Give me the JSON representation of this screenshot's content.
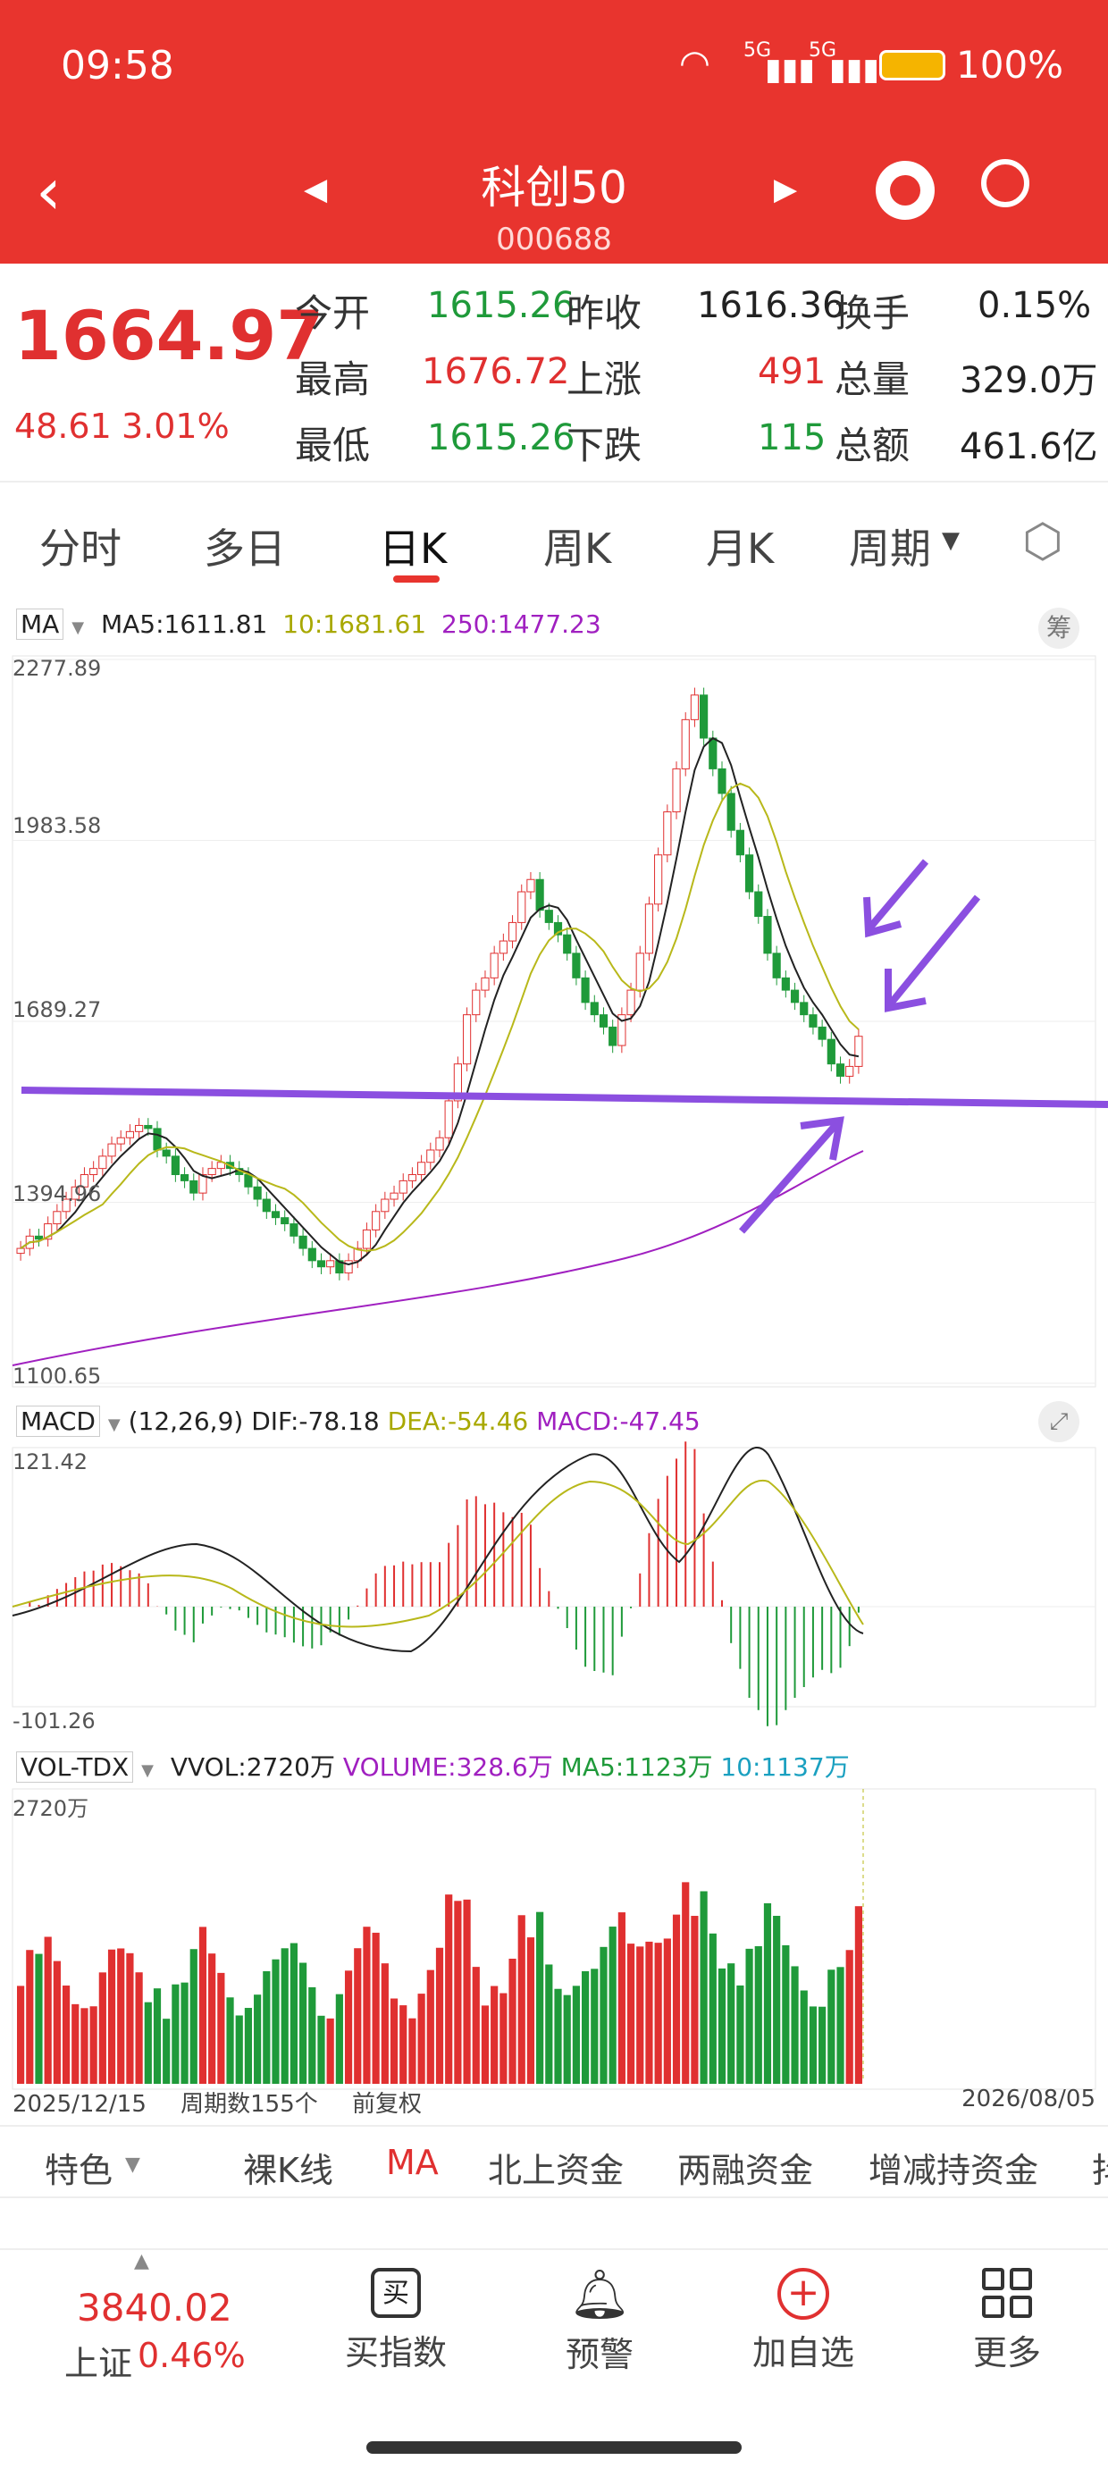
{
  "status_bar": {
    "time": "09:58",
    "signal1": "5G",
    "signal2": "5G",
    "battery": "100%"
  },
  "header": {
    "title": "科创50",
    "code": "000688"
  },
  "quote": {
    "price": "1664.97",
    "change": "48.61",
    "change_pct": "3.01%",
    "open_label": "今开",
    "open": "1615.26",
    "prev_label": "昨收",
    "prev": "1616.36",
    "turnover_label": "换手",
    "turnover": "0.15%",
    "high_label": "最高",
    "high": "1676.72",
    "up_label": "上涨",
    "up": "491",
    "vol_label": "总量",
    "vol": "329.0万",
    "low_label": "最低",
    "low": "1615.26",
    "down_label": "下跌",
    "down": "115",
    "amt_label": "总额",
    "amt": "461.6亿"
  },
  "tabs": [
    "分时",
    "多日",
    "日K",
    "周K",
    "月K",
    "周期"
  ],
  "main_chart": {
    "indicator": "MA",
    "ma5": "MA5:1611.81",
    "ma10": "10:1681.61",
    "ma250": "250:1477.23",
    "chip_btn": "筹",
    "y_labels": [
      "2277.89",
      "1983.58",
      "1689.27",
      "1394.96",
      "1100.65"
    ]
  },
  "macd": {
    "indicator": "MACD",
    "params": "(12,26,9)",
    "dif": "DIF:-78.18",
    "dea": "DEA:-54.46",
    "macd": "MACD:-47.45",
    "y_top": "121.42",
    "y_bottom": "-101.26"
  },
  "vol": {
    "indicator": "VOL-TDX",
    "vvol": "VVOL:2720万",
    "volume": "VOLUME:328.6万",
    "ma5": "MA5:1123万",
    "ma10": "10:1137万",
    "y_top": "2720万"
  },
  "footer_axis": {
    "start": "2025/12/15",
    "period": "周期数155个",
    "adj": "前复权",
    "end": "2026/08/05"
  },
  "indicator_bar": [
    "特色",
    "裸K线",
    "MA",
    "北上资金",
    "两融资金",
    "增减持资金",
    "抖"
  ],
  "bottom_nav": {
    "index_value": "3840.02",
    "index_name": "上证",
    "index_pct": "0.46%",
    "items": [
      "买指数",
      "预警",
      "加自选",
      "更多"
    ]
  },
  "colors": {
    "up": "#e03030",
    "down": "#1f9a3a",
    "accent": "#e8342e",
    "ma5": "#222222",
    "ma10": "#b8b81a",
    "ma250": "#a020c0",
    "annot": "#8b4fe0"
  },
  "chart_data": {
    "type": "candlestick",
    "series": [
      {
        "name": "MA5",
        "last": 1611.81
      },
      {
        "name": "MA10",
        "last": 1681.61
      },
      {
        "name": "MA250",
        "last": 1477.23
      }
    ],
    "y_range": [
      1100.65,
      2277.89
    ],
    "candles_count": 155,
    "closes": [
      1320,
      1340,
      1335,
      1360,
      1380,
      1400,
      1420,
      1440,
      1450,
      1470,
      1490,
      1500,
      1510,
      1520,
      1515,
      1480,
      1470,
      1440,
      1430,
      1410,
      1440,
      1450,
      1460,
      1450,
      1440,
      1420,
      1400,
      1380,
      1370,
      1360,
      1340,
      1320,
      1300,
      1290,
      1300,
      1280,
      1300,
      1320,
      1350,
      1380,
      1400,
      1410,
      1430,
      1440,
      1460,
      1480,
      1500,
      1560,
      1620,
      1700,
      1740,
      1760,
      1800,
      1820,
      1850,
      1900,
      1920,
      1870,
      1850,
      1830,
      1800,
      1760,
      1720,
      1700,
      1680,
      1650,
      1700,
      1740,
      1800,
      1880,
      1960,
      2030,
      2100,
      2180,
      2220,
      2150,
      2100,
      2060,
      2000,
      1960,
      1900,
      1860,
      1800,
      1760,
      1740,
      1720,
      1700,
      1680,
      1660,
      1620,
      1600,
      1616,
      1665
    ]
  }
}
